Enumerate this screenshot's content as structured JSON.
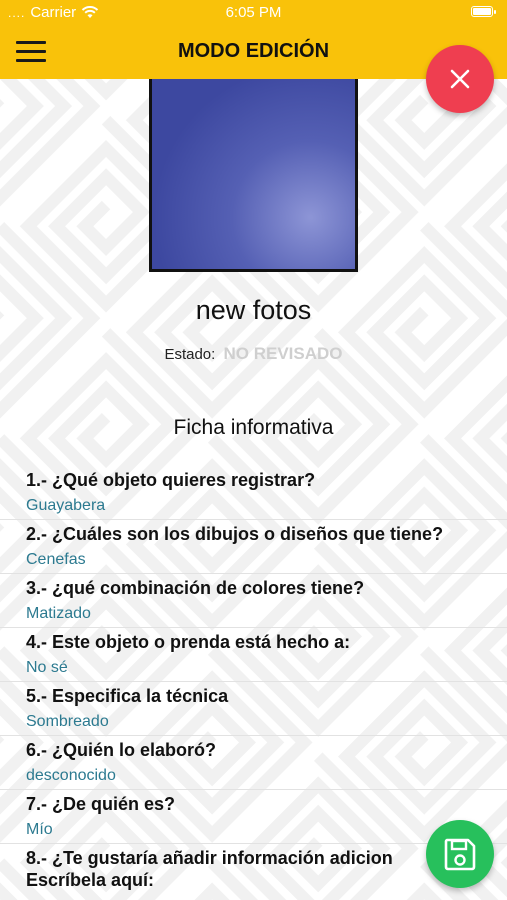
{
  "status_bar": {
    "dots": "....",
    "carrier": "Carrier",
    "time": "6:05 PM"
  },
  "header": {
    "title": "MODO EDICIÓN"
  },
  "item": {
    "name": "new fotos",
    "estado_label": "Estado:",
    "estado_value": "NO REVISADO"
  },
  "section_title": "Ficha informativa",
  "questions": [
    {
      "q": "1.- ¿Qué objeto quieres registrar?",
      "a": "Guayabera"
    },
    {
      "q": "2.- ¿Cuáles son los dibujos o diseños que tiene?",
      "a": "Cenefas"
    },
    {
      "q": "3.- ¿qué combinación de colores tiene?",
      "a": "Matizado"
    },
    {
      "q": "4.- Este objeto o prenda está hecho a:",
      "a": "No sé"
    },
    {
      "q": "5.- Especifica la técnica",
      "a": "Sombreado"
    },
    {
      "q": "6.- ¿Quién lo elaboró?",
      "a": "desconocido"
    },
    {
      "q": "7.- ¿De quién es?",
      "a": "Mío"
    },
    {
      "q": "8.- ¿Te gustaría añadir información adicion",
      "a": "Escríbela aquí:"
    }
  ],
  "colors": {
    "appbar": "#f9c20a",
    "close_fab": "#ef3e50",
    "save_fab": "#27c05c",
    "answer_text": "#2c7a90",
    "estado_value": "#cfcfcf"
  },
  "icons": {
    "menu": "hamburger-menu-icon",
    "close": "close-icon",
    "save": "floppy-disk-icon",
    "wifi": "wifi-icon",
    "battery": "battery-icon"
  }
}
